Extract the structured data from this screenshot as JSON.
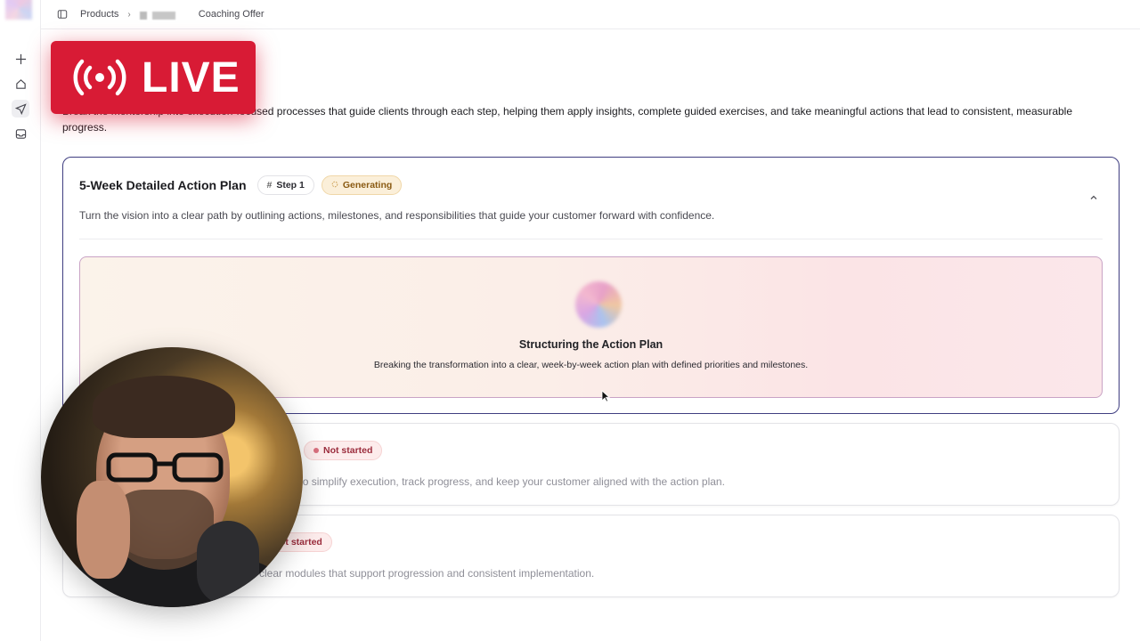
{
  "breadcrumb": {
    "products": "Products",
    "current": "Coaching Offer"
  },
  "intro_text": "Break the mentorship into execution-focused processes that guide clients through each step, helping them apply insights, complete guided exercises, and take meaningful actions that lead to consistent, measurable progress.",
  "active_step": {
    "title": "5-Week Detailed Action Plan",
    "step_badge": "Step 1",
    "status_badge": "Generating",
    "description": "Turn the vision into a clear path by outlining actions, milestones, and responsibilities that guide your customer forward with confidence.",
    "panel": {
      "title": "Structuring the Action Plan",
      "subtitle": "Breaking the transformation into a clear, week-by-week action plan with defined priorities and milestones."
    }
  },
  "pending_steps": [
    {
      "status_badge": "Not started",
      "description_visible": "ned to simplify execution, track progress, and keep your customer aligned with the action plan."
    },
    {
      "status_badge": "ot started",
      "description_visible": "clear modules that support progression and consistent implementation."
    }
  ],
  "overlay": {
    "live_label": "LIVE"
  },
  "colors": {
    "accent_border": "#3f3e80",
    "live_red": "#d81b35",
    "generating_bg": "#fbefd9",
    "not_started_bg": "#fdecec"
  }
}
